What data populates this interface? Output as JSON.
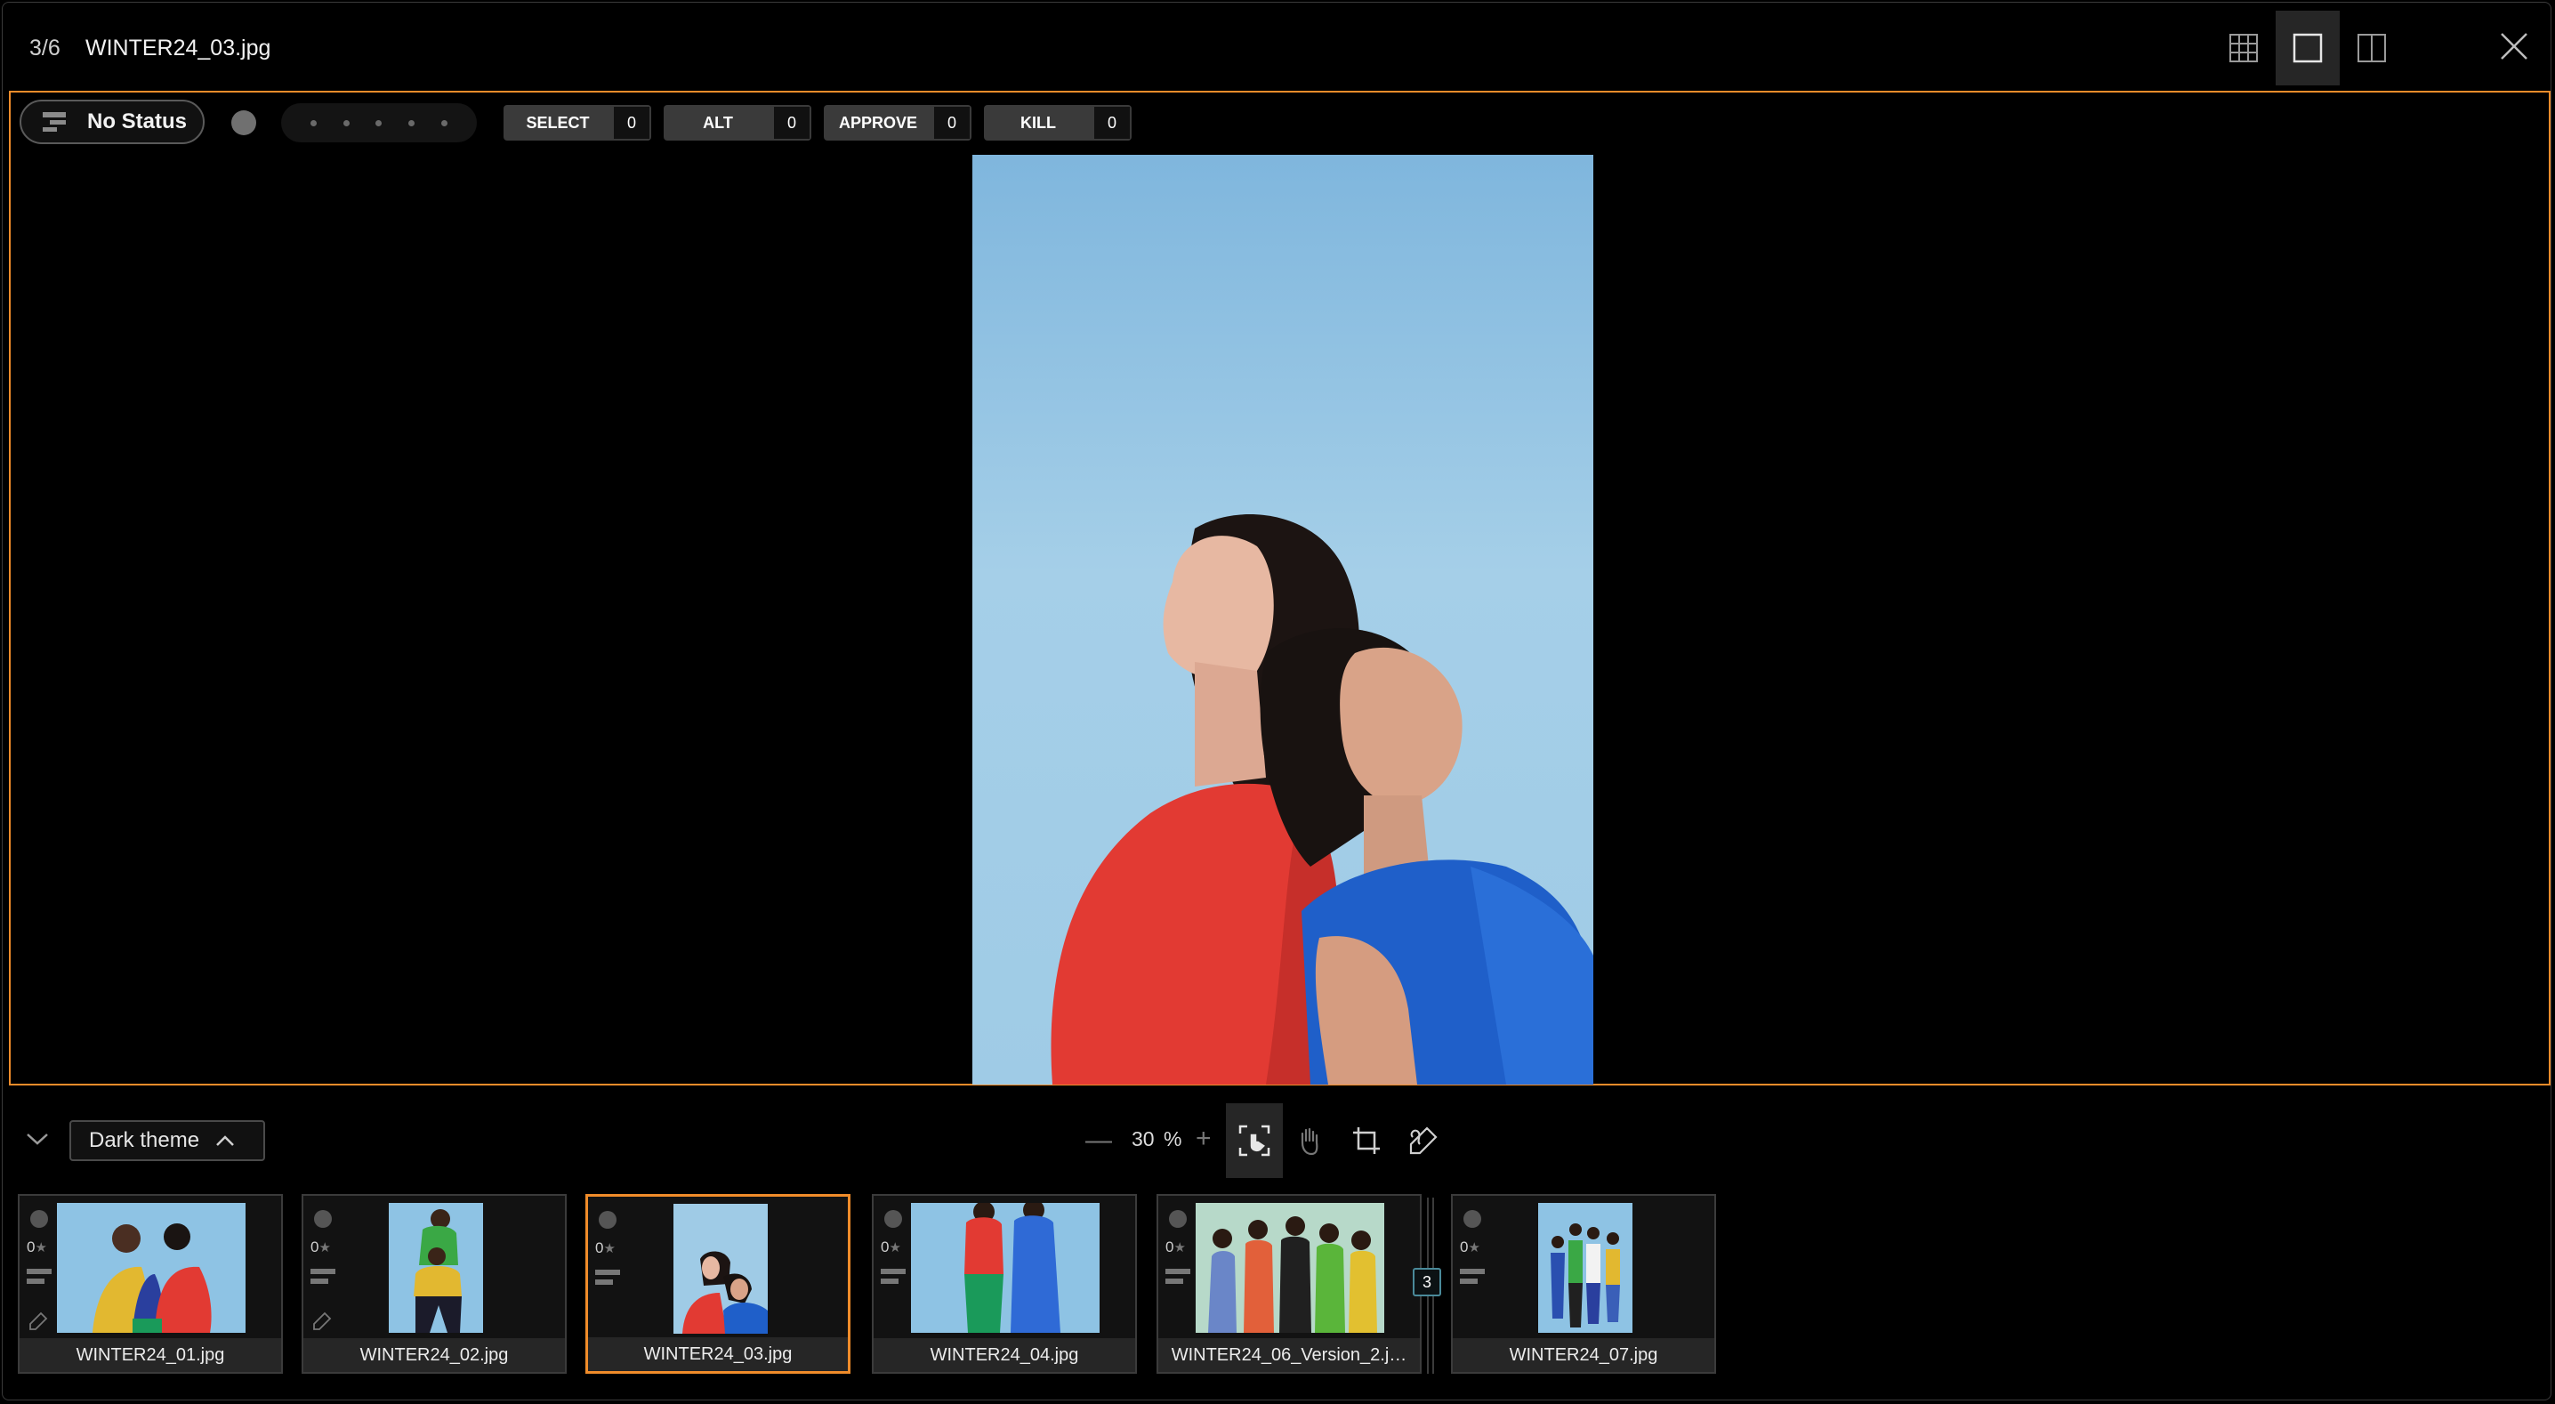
{
  "header": {
    "counter": "3/6",
    "filename": "WINTER24_03.jpg",
    "view_icons": [
      "grid-view-icon",
      "single-view-icon",
      "compare-view-icon"
    ],
    "close_icon": "close-icon"
  },
  "viewer": {
    "status_label": "No Status",
    "votes": [
      {
        "label": "SELECT",
        "count": "0"
      },
      {
        "label": "ALT",
        "count": "0"
      },
      {
        "label": "APPROVE",
        "count": "0"
      },
      {
        "label": "KILL",
        "count": "0"
      }
    ],
    "accent_color": "#f08c2a"
  },
  "toolbar": {
    "theme_label": "Dark theme",
    "zoom_value": "30",
    "zoom_unit": "%",
    "zoom_minus": "—",
    "zoom_plus": "+",
    "tools": [
      "fit-screen-icon",
      "hand-pan-icon",
      "crop-icon",
      "annotate-pen-icon"
    ]
  },
  "filmstrip": {
    "items": [
      {
        "name": "WINTER24_01.jpg",
        "rating": "0",
        "star": "★"
      },
      {
        "name": "WINTER24_02.jpg",
        "rating": "0",
        "star": "★"
      },
      {
        "name": "WINTER24_03.jpg",
        "rating": "0",
        "star": "★"
      },
      {
        "name": "WINTER24_04.jpg",
        "rating": "0",
        "star": "★"
      },
      {
        "name": "WINTER24_06_Version_2.j…",
        "rating": "0",
        "star": "★"
      },
      {
        "name": "WINTER24_07.jpg",
        "rating": "0",
        "star": "★"
      }
    ],
    "stack_count": "3"
  }
}
